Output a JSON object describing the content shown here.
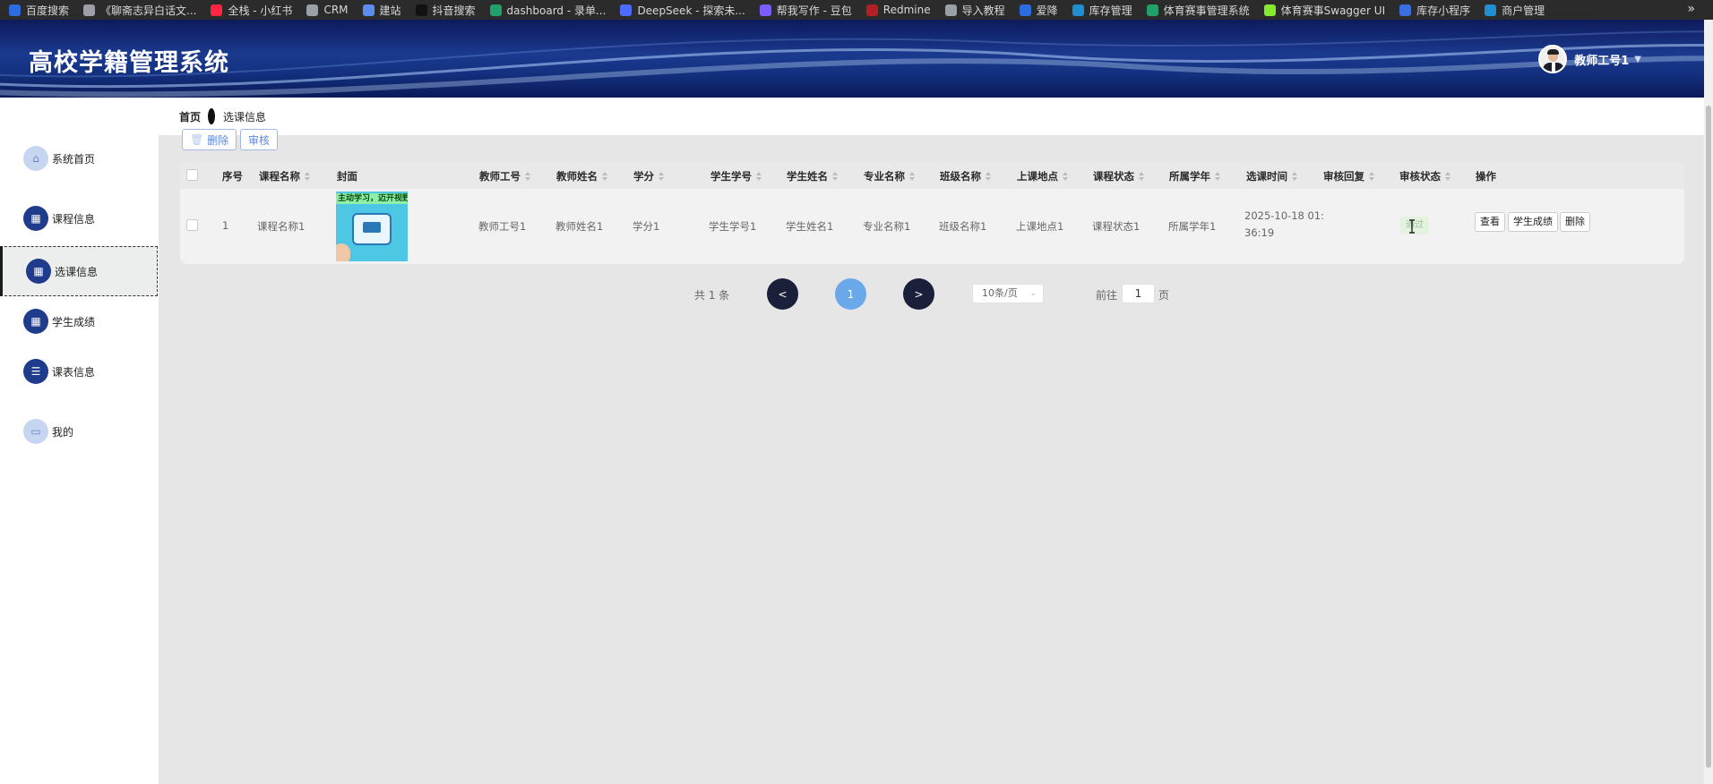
{
  "bookmarks": [
    {
      "label": "百度搜索",
      "color": "#2d6be0"
    },
    {
      "label": "《聊斋志异白话文...",
      "color": "#9aa0a6"
    },
    {
      "label": "全栈 - 小红书",
      "color": "#ff2442"
    },
    {
      "label": "CRM",
      "color": "#9aa0a6"
    },
    {
      "label": "建站",
      "color": "#5b8def"
    },
    {
      "label": "抖音搜索",
      "color": "#111111"
    },
    {
      "label": "dashboard - 录单...",
      "color": "#22a06b"
    },
    {
      "label": "DeepSeek - 探索未...",
      "color": "#4d6bfe"
    },
    {
      "label": "帮我写作 - 豆包",
      "color": "#7d5cff"
    },
    {
      "label": "Redmine",
      "color": "#b32024"
    },
    {
      "label": "导入教程",
      "color": "#9aa0a6"
    },
    {
      "label": "爱降",
      "color": "#2d6be0"
    },
    {
      "label": "库存管理",
      "color": "#1f8fd1"
    },
    {
      "label": "体育赛事管理系统",
      "color": "#22a06b"
    },
    {
      "label": "体育赛事Swagger UI",
      "color": "#85ea2d"
    },
    {
      "label": "库存小程序",
      "color": "#3b6fe0"
    },
    {
      "label": "商户管理",
      "color": "#1f8fd1"
    }
  ],
  "bookmarks_more": "»",
  "header": {
    "title": "高校学籍管理系统",
    "user": "教师工号1",
    "caret": "▼"
  },
  "sidebar": {
    "items": [
      {
        "label": "系统首页",
        "icon": "home-icon",
        "style": "light"
      },
      {
        "label": "课程信息",
        "icon": "grid-icon",
        "style": "dark"
      },
      {
        "label": "选课信息",
        "icon": "grid-icon",
        "style": "dark",
        "active": true
      },
      {
        "label": "学生成绩",
        "icon": "grid-icon",
        "style": "dark"
      },
      {
        "label": "课表信息",
        "icon": "sliders-icon",
        "style": "dark"
      },
      {
        "label": "我的",
        "icon": "card-icon",
        "style": "light"
      }
    ]
  },
  "breadcrumb": {
    "home": "首页",
    "current": "选课信息"
  },
  "toolbar": {
    "delete_label": "删除",
    "audit_label": "审核"
  },
  "table": {
    "columns": [
      "序号",
      "课程名称",
      "封面",
      "教师工号",
      "教师姓名",
      "学分",
      "学生学号",
      "学生姓名",
      "专业名称",
      "班级名称",
      "上课地点",
      "课程状态",
      "所属学年",
      "选课时间",
      "审核回复",
      "审核状态",
      "操作"
    ],
    "rows": [
      {
        "index": "1",
        "course_name": "课程名称1",
        "cover_banner": "主动学习，迈开视野",
        "teacher_no": "教师工号1",
        "teacher_name": "教师姓名1",
        "credit": "学分1",
        "student_no": "学生学号1",
        "student_name": "学生姓名1",
        "major": "专业名称1",
        "class_name": "班级名称1",
        "location": "上课地点1",
        "course_status": "课程状态1",
        "school_year": "所属学年1",
        "select_time_date": "2025-10-18 01:",
        "select_time_time": "36:19",
        "audit_reply": "",
        "audit_status": "通过",
        "actions": {
          "view": "查看",
          "scores": "学生成绩",
          "delete": "删除"
        }
      }
    ]
  },
  "pagination": {
    "total_text": "共 1 条",
    "prev": "<",
    "current_page": "1",
    "next": ">",
    "page_size": "10条/页",
    "goto_label": "前往",
    "goto_value": "1",
    "goto_suffix": "页"
  },
  "colors": {
    "header_bg": "#13307e",
    "nav_icon": "#1f3b8c",
    "current_page": "#6ba8ea",
    "pager_nav": "#1a1f3a"
  }
}
